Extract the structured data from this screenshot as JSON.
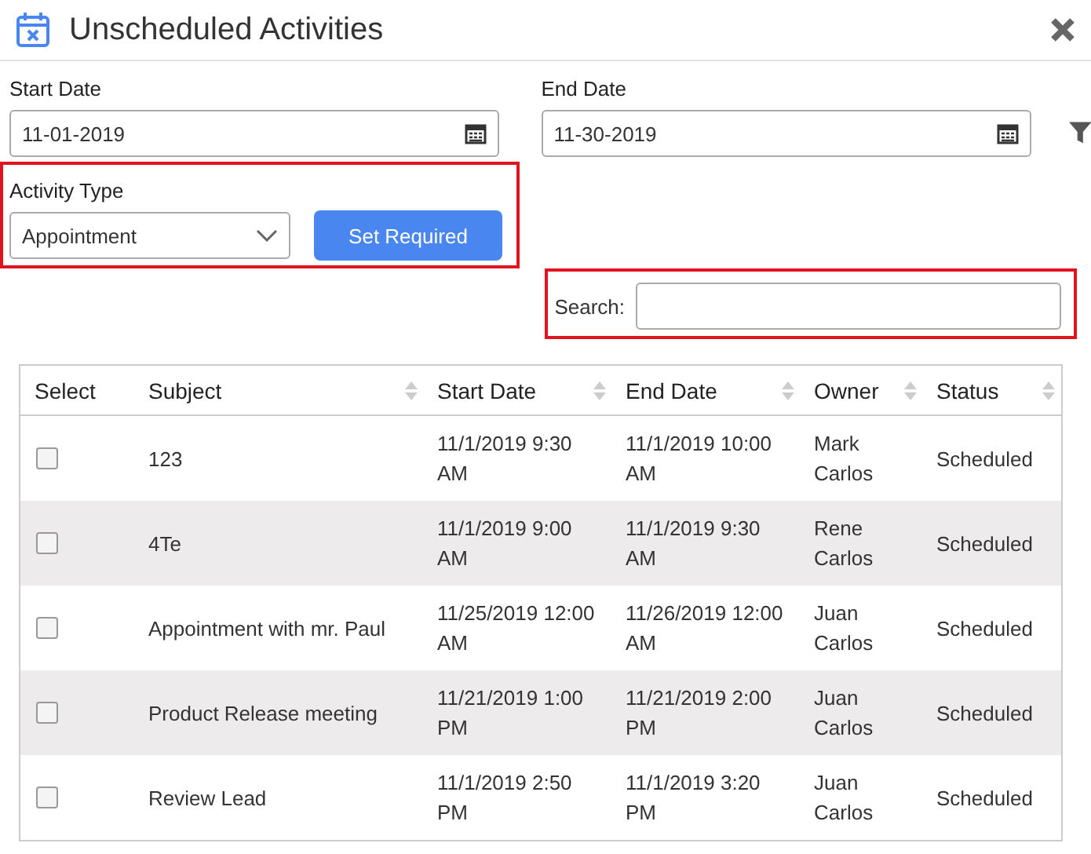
{
  "window": {
    "title": "Unscheduled Activities"
  },
  "start_date": {
    "label": "Start Date",
    "value": "11-01-2019"
  },
  "end_date": {
    "label": "End Date",
    "value": "11-30-2019"
  },
  "activity_type": {
    "label": "Activity Type",
    "value": "Appointment"
  },
  "set_required_button": "Set Required",
  "search": {
    "label": "Search:"
  },
  "table": {
    "columns": [
      {
        "label": "Select",
        "sortable": false
      },
      {
        "label": "Subject",
        "sortable": true
      },
      {
        "label": "Start Date",
        "sortable": true
      },
      {
        "label": "End Date",
        "sortable": true
      },
      {
        "label": "Owner",
        "sortable": true
      },
      {
        "label": "Status",
        "sortable": true
      }
    ],
    "rows": [
      {
        "checked": false,
        "subject": "123",
        "start": "11/1/2019 9:30 AM",
        "end": "11/1/2019 10:00 AM",
        "owner": "Mark Carlos",
        "status": "Scheduled"
      },
      {
        "checked": false,
        "subject": "4Te",
        "start": "11/1/2019 9:00 AM",
        "end": "11/1/2019 9:30 AM",
        "owner": "Rene Carlos",
        "status": "Scheduled"
      },
      {
        "checked": false,
        "subject": "Appointment with mr. Paul",
        "start": "11/25/2019 12:00 AM",
        "end": "11/26/2019 12:00 AM",
        "owner": "Juan Carlos",
        "status": "Scheduled"
      },
      {
        "checked": false,
        "subject": "Product Release meeting",
        "start": "11/21/2019 1:00 PM",
        "end": "11/21/2019 2:00 PM",
        "owner": "Juan Carlos",
        "status": "Scheduled"
      },
      {
        "checked": false,
        "subject": "Review Lead",
        "start": "11/1/2019 2:50 PM",
        "end": "11/1/2019 3:20 PM",
        "owner": "Juan Carlos",
        "status": "Scheduled"
      }
    ]
  }
}
